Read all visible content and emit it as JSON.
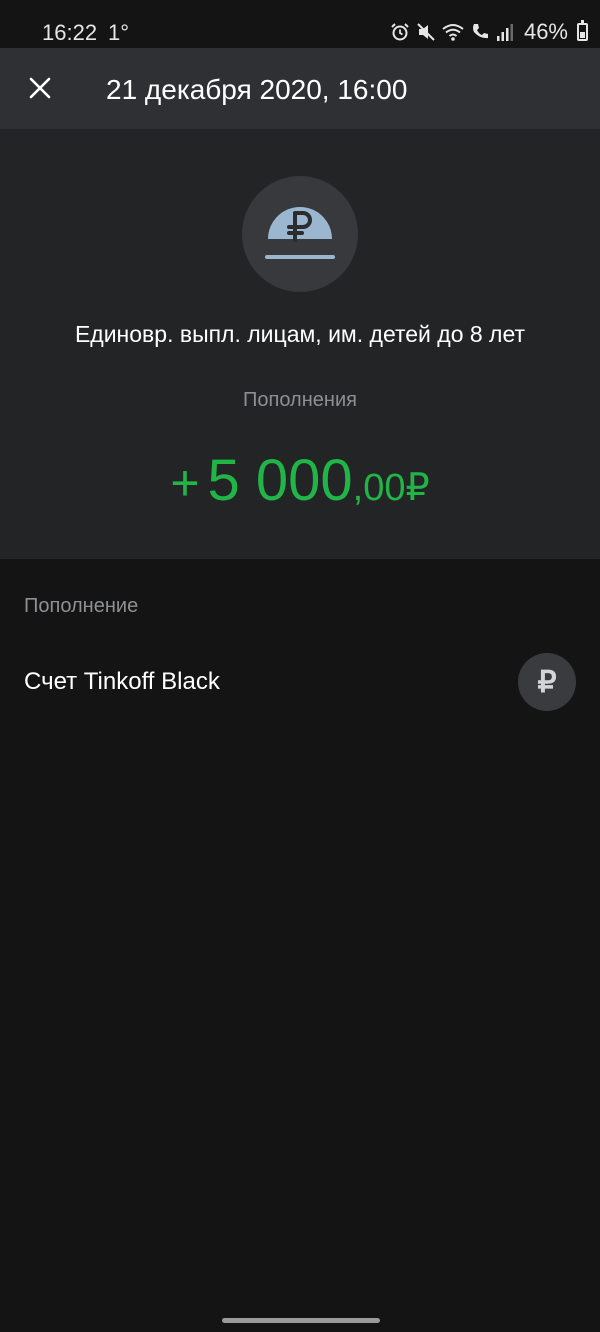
{
  "status_bar": {
    "time": "16:22",
    "temperature": "1°",
    "battery": "46%",
    "icons": [
      "alarm-icon",
      "mute-icon",
      "wifi-icon",
      "wifi-call-icon",
      "signal-icon",
      "battery-icon"
    ]
  },
  "header": {
    "title": "21 декабря 2020, 16:00",
    "close_icon": "close-icon"
  },
  "transaction": {
    "icon": "ruble-coin-icon",
    "description": "Единовр. выпл. лицам, им. детей до 8 лет",
    "category": "Пополнения",
    "amount": {
      "sign": "+",
      "integer": "5 000",
      "fraction": ",00",
      "currency": "₽"
    },
    "amount_color": "#21b547"
  },
  "details": {
    "section_label": "Пополнение",
    "account_name": "Счет Tinkoff Black",
    "account_icon": "ruble-icon",
    "account_icon_glyph": "₽"
  },
  "colors": {
    "background": "#141414",
    "header_bg": "#2f3033",
    "hero_bg": "#232426",
    "secondary_text": "#8e8f93",
    "coin_fill": "#9bb7cf"
  }
}
